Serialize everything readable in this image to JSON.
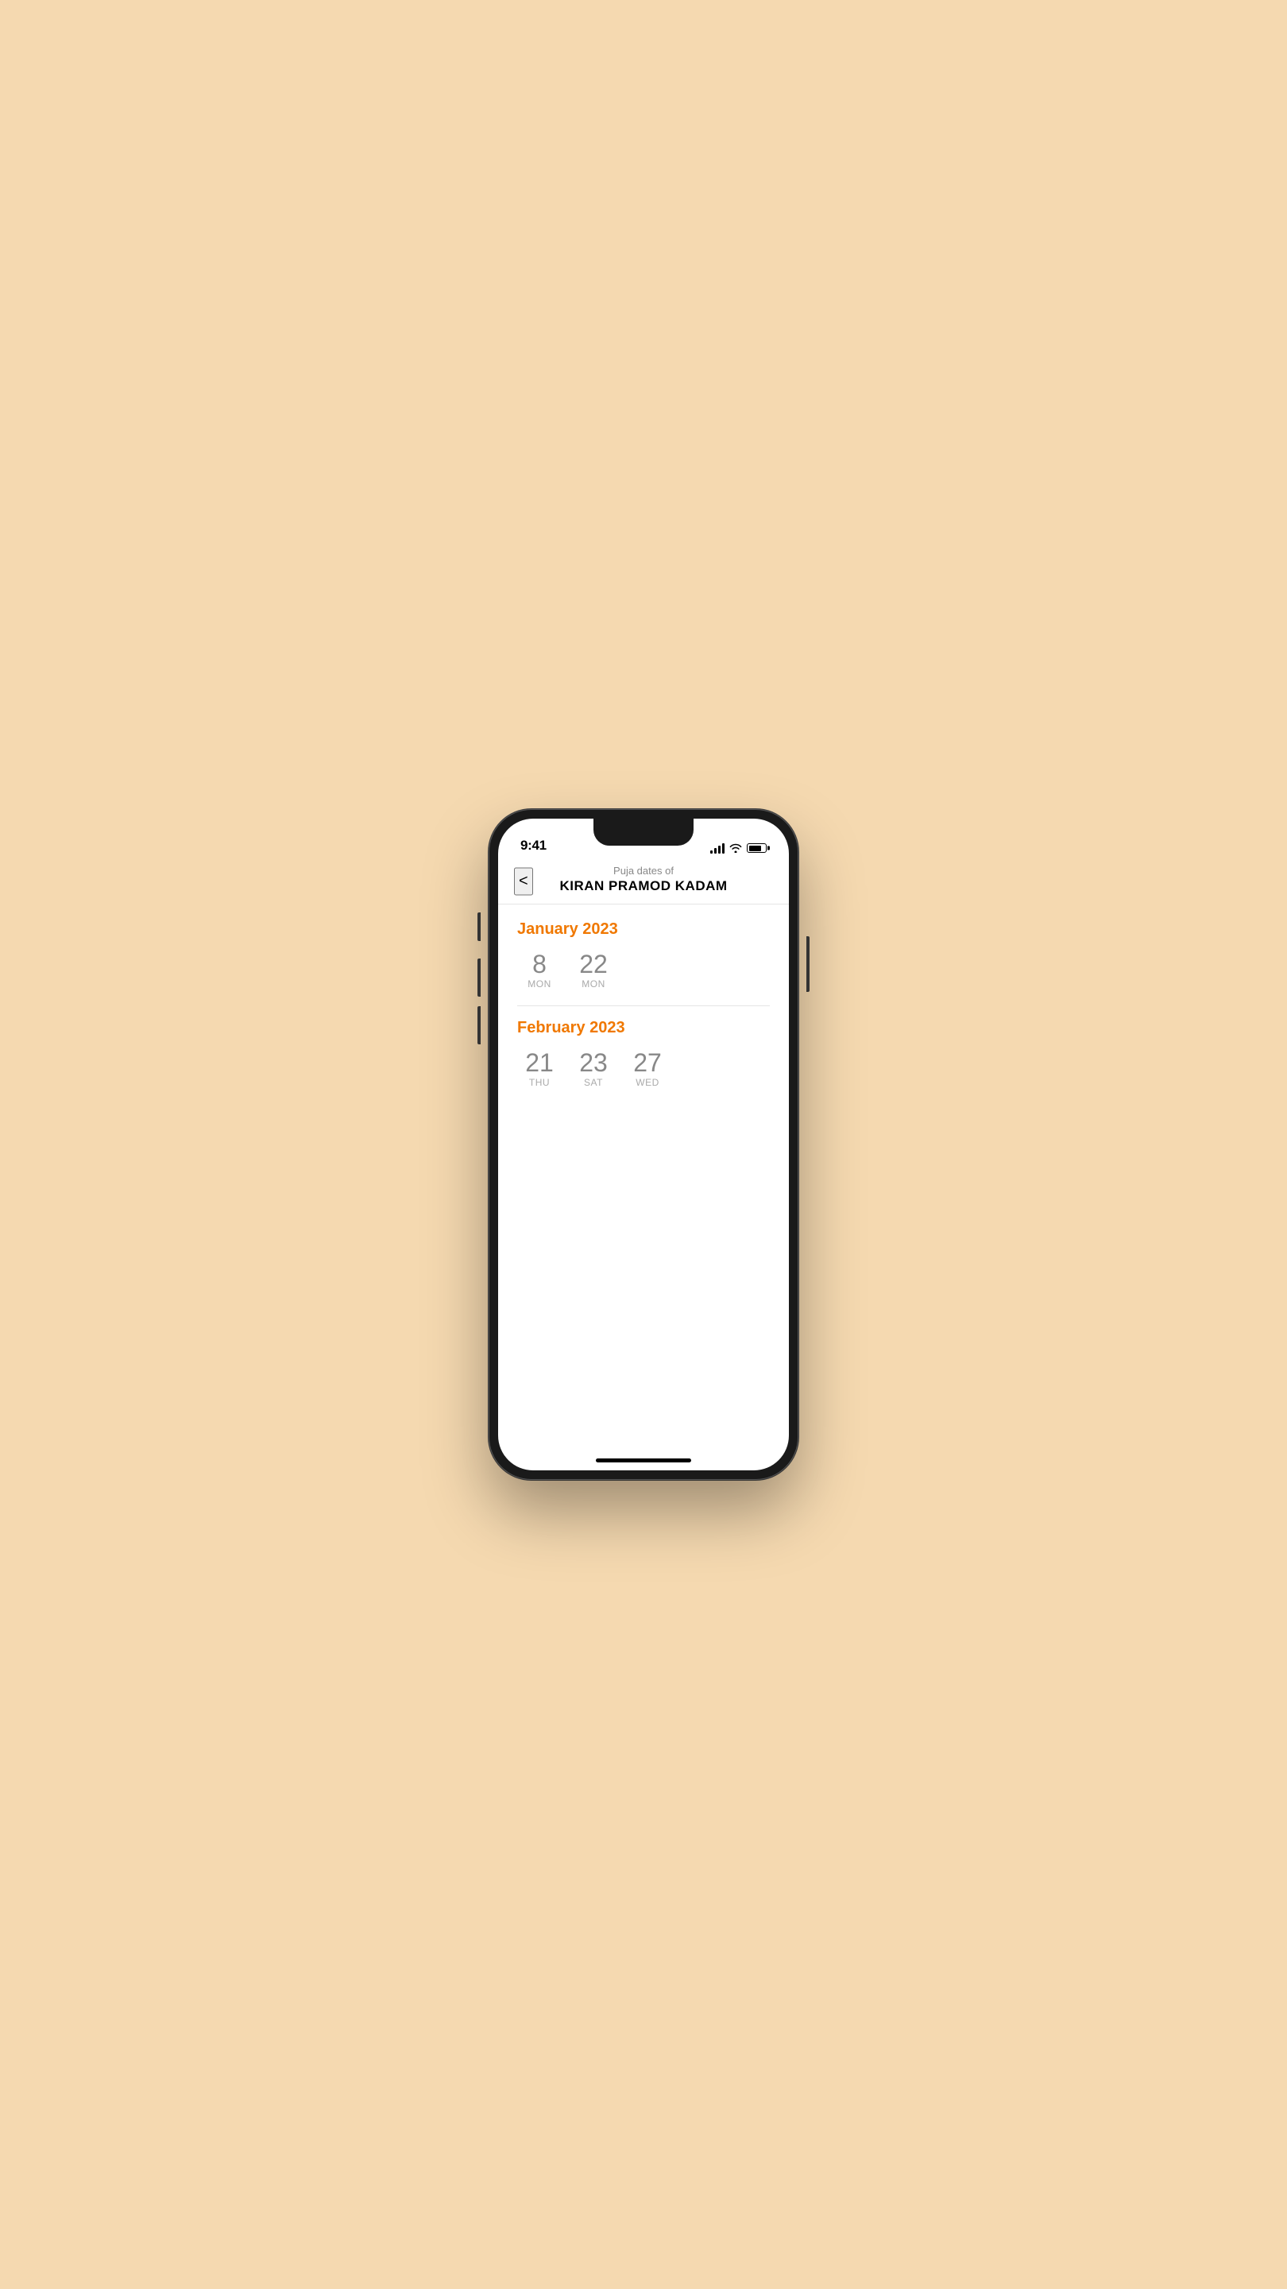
{
  "phone": {
    "status_bar": {
      "time": "9:41"
    },
    "header": {
      "subtitle": "Puja dates of",
      "title": "KIRAN PRAMOD KADAM",
      "back_label": "<"
    },
    "months": [
      {
        "id": "jan2023",
        "label": "January 2023",
        "dates": [
          {
            "number": "8",
            "day": "MON"
          },
          {
            "number": "22",
            "day": "MON"
          }
        ]
      },
      {
        "id": "feb2023",
        "label": "February 2023",
        "dates": [
          {
            "number": "21",
            "day": "THU"
          },
          {
            "number": "23",
            "day": "SAT"
          },
          {
            "number": "27",
            "day": "WED"
          }
        ]
      }
    ],
    "colors": {
      "accent": "#f07800",
      "text_primary": "#000000",
      "text_muted": "#888888",
      "divider": "#e5e5e5"
    }
  }
}
